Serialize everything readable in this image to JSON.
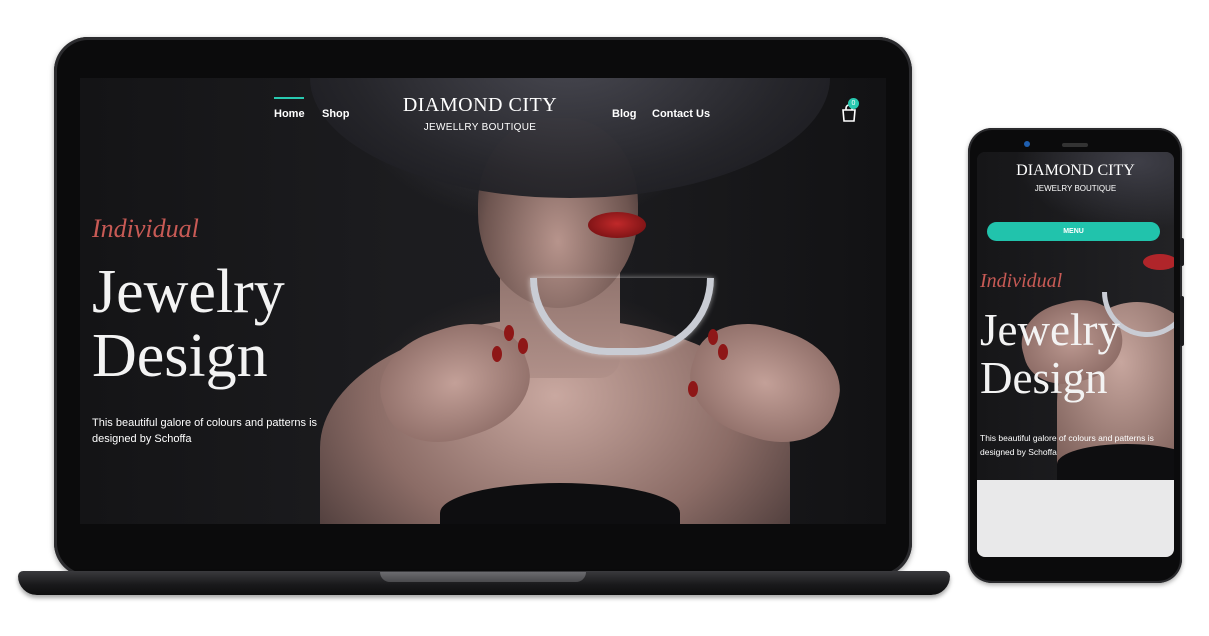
{
  "desktop": {
    "nav": {
      "left": [
        "Home",
        "Shop"
      ],
      "right": [
        "Blog",
        "Contact Us"
      ],
      "active": "Home"
    },
    "brand": {
      "title": "DIAMOND CITY",
      "subtitle": "JEWELLRY BOUTIQUE"
    },
    "cart": {
      "icon": "shopping-bag-icon",
      "count": "0"
    },
    "hero": {
      "kicker": "Individual",
      "title_line1": "Jewelry",
      "title_line2": "Design",
      "description": "This beautiful galore of colours and patterns is designed by Schoffa"
    }
  },
  "mobile": {
    "brand": {
      "title": "DIAMOND CITY",
      "subtitle": "JEWELRY BOUTIQUE"
    },
    "menu_button": "MENU",
    "hero": {
      "kicker": "Individual",
      "title_line1": "Jewelry",
      "title_line2": "Design",
      "description": "This beautiful galore of colours and patterns is designed by Schoffa"
    }
  },
  "colors": {
    "accent": "#28c9b0",
    "kicker": "#c85a55",
    "device": "#0b0b0c"
  }
}
